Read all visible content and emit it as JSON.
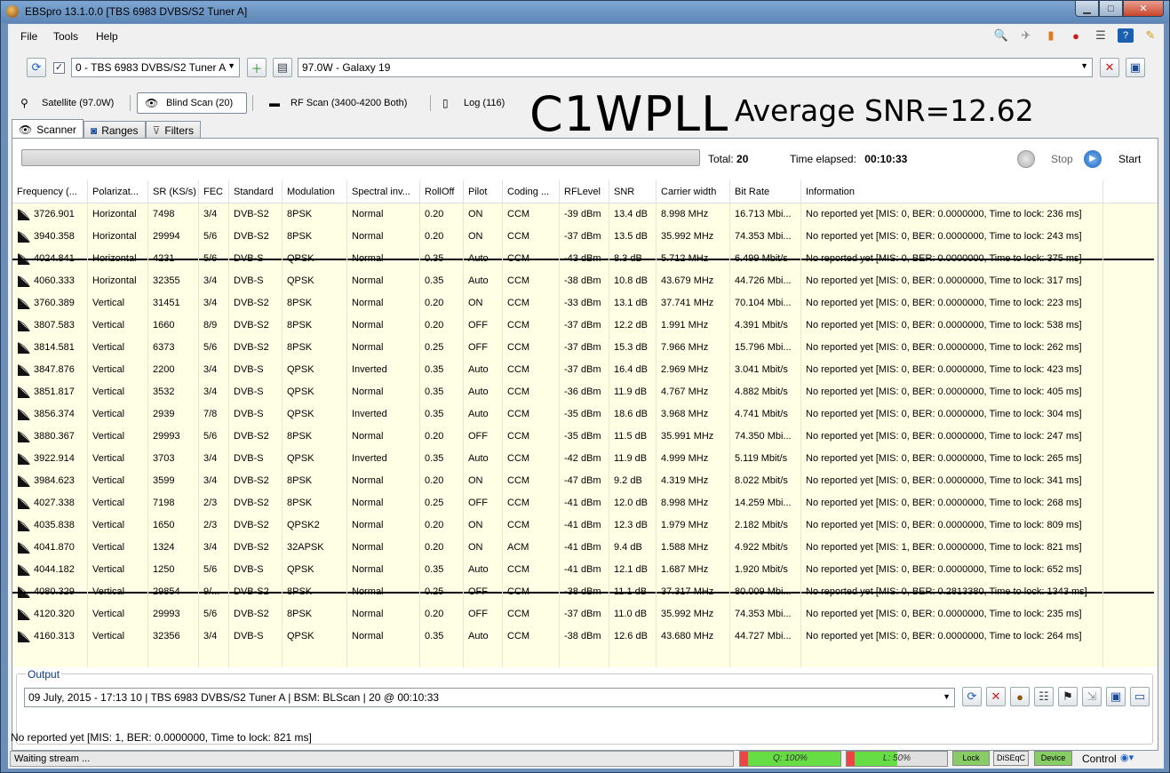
{
  "window": {
    "title": "EBSpro 13.1.0.0 [TBS 6983 DVBS/S2 Tuner A]"
  },
  "menu": {
    "file": "File",
    "tools": "Tools",
    "help": "Help"
  },
  "toolbar": {
    "tuner": "0 - TBS 6983 DVBS/S2 Tuner A",
    "satellite": "97.0W - Galaxy 19"
  },
  "tabs": {
    "satellite": "Satellite (97.0W)",
    "blind_scan": "Blind Scan (20)",
    "rf_scan": "RF Scan (3400-4200 Both)",
    "log": "Log (116)"
  },
  "overlay": {
    "callsign": "C1WPLL",
    "avg_snr": "Average SNR=12.62"
  },
  "subtabs": {
    "scanner": "Scanner",
    "ranges": "Ranges",
    "filters": "Filters"
  },
  "scanner": {
    "total_label": "Total:",
    "total_value": "20",
    "elapsed_label": "Time elapsed:",
    "elapsed_value": "00:10:33",
    "stop": "Stop",
    "start": "Start"
  },
  "columns": [
    "Frequency (...",
    "Polarizat...",
    "SR (KS/s)",
    "FEC",
    "Standard",
    "Modulation",
    "Spectral inv...",
    "RollOff",
    "Pilot",
    "Coding ...",
    "RFLevel",
    "SNR",
    "Carrier width",
    "Bit Rate",
    "Information"
  ],
  "rows": [
    {
      "f": "3726.901",
      "p": "Horizontal",
      "sr": "7498",
      "fec": "3/4",
      "std": "DVB-S2",
      "mod": "8PSK",
      "inv": "Normal",
      "ro": "0.20",
      "pilot": "ON",
      "cod": "CCM",
      "rf": "-39 dBm",
      "snr": "13.4 dB",
      "cw": "8.998 MHz",
      "br": "16.713 Mbi...",
      "info": "No reported yet [MIS: 0, BER: 0.0000000, Time to lock: 236 ms]",
      "struck": false
    },
    {
      "f": "3940.358",
      "p": "Horizontal",
      "sr": "29994",
      "fec": "5/6",
      "std": "DVB-S2",
      "mod": "8PSK",
      "inv": "Normal",
      "ro": "0.20",
      "pilot": "ON",
      "cod": "CCM",
      "rf": "-37 dBm",
      "snr": "13.5 dB",
      "cw": "35.992 MHz",
      "br": "74.353 Mbi...",
      "info": "No reported yet [MIS: 0, BER: 0.0000000, Time to lock: 243 ms]",
      "struck": false
    },
    {
      "f": "4024.841",
      "p": "Horizontal",
      "sr": "4231",
      "fec": "5/6",
      "std": "DVB-S",
      "mod": "QPSK",
      "inv": "Normal",
      "ro": "0.35",
      "pilot": "Auto",
      "cod": "CCM",
      "rf": "-43 dBm",
      "snr": "8.3 dB",
      "cw": "5.712 MHz",
      "br": "6.499 Mbit/s",
      "info": "No reported yet [MIS: 0, BER: 0.0000000, Time to lock: 375 ms]",
      "struck": true
    },
    {
      "f": "4060.333",
      "p": "Horizontal",
      "sr": "32355",
      "fec": "3/4",
      "std": "DVB-S",
      "mod": "QPSK",
      "inv": "Normal",
      "ro": "0.35",
      "pilot": "Auto",
      "cod": "CCM",
      "rf": "-38 dBm",
      "snr": "10.8 dB",
      "cw": "43.679 MHz",
      "br": "44.726 Mbi...",
      "info": "No reported yet [MIS: 0, BER: 0.0000000, Time to lock: 317 ms]",
      "struck": false
    },
    {
      "f": "3760.389",
      "p": "Vertical",
      "sr": "31451",
      "fec": "3/4",
      "std": "DVB-S2",
      "mod": "8PSK",
      "inv": "Normal",
      "ro": "0.20",
      "pilot": "ON",
      "cod": "CCM",
      "rf": "-33 dBm",
      "snr": "13.1 dB",
      "cw": "37.741 MHz",
      "br": "70.104 Mbi...",
      "info": "No reported yet [MIS: 0, BER: 0.0000000, Time to lock: 223 ms]",
      "struck": false
    },
    {
      "f": "3807.583",
      "p": "Vertical",
      "sr": "1660",
      "fec": "8/9",
      "std": "DVB-S2",
      "mod": "8PSK",
      "inv": "Normal",
      "ro": "0.20",
      "pilot": "OFF",
      "cod": "CCM",
      "rf": "-37 dBm",
      "snr": "12.2 dB",
      "cw": "1.991 MHz",
      "br": "4.391 Mbit/s",
      "info": "No reported yet [MIS: 0, BER: 0.0000000, Time to lock: 538 ms]",
      "struck": false
    },
    {
      "f": "3814.581",
      "p": "Vertical",
      "sr": "6373",
      "fec": "5/6",
      "std": "DVB-S2",
      "mod": "8PSK",
      "inv": "Normal",
      "ro": "0.25",
      "pilot": "OFF",
      "cod": "CCM",
      "rf": "-37 dBm",
      "snr": "15.3 dB",
      "cw": "7.966 MHz",
      "br": "15.796 Mbi...",
      "info": "No reported yet [MIS: 0, BER: 0.0000000, Time to lock: 262 ms]",
      "struck": false
    },
    {
      "f": "3847.876",
      "p": "Vertical",
      "sr": "2200",
      "fec": "3/4",
      "std": "DVB-S",
      "mod": "QPSK",
      "inv": "Inverted",
      "ro": "0.35",
      "pilot": "Auto",
      "cod": "CCM",
      "rf": "-37 dBm",
      "snr": "16.4 dB",
      "cw": "2.969 MHz",
      "br": "3.041 Mbit/s",
      "info": "No reported yet [MIS: 0, BER: 0.0000000, Time to lock: 423 ms]",
      "struck": false
    },
    {
      "f": "3851.817",
      "p": "Vertical",
      "sr": "3532",
      "fec": "3/4",
      "std": "DVB-S",
      "mod": "QPSK",
      "inv": "Normal",
      "ro": "0.35",
      "pilot": "Auto",
      "cod": "CCM",
      "rf": "-36 dBm",
      "snr": "11.9 dB",
      "cw": "4.767 MHz",
      "br": "4.882 Mbit/s",
      "info": "No reported yet [MIS: 0, BER: 0.0000000, Time to lock: 405 ms]",
      "struck": false
    },
    {
      "f": "3856.374",
      "p": "Vertical",
      "sr": "2939",
      "fec": "7/8",
      "std": "DVB-S",
      "mod": "QPSK",
      "inv": "Inverted",
      "ro": "0.35",
      "pilot": "Auto",
      "cod": "CCM",
      "rf": "-35 dBm",
      "snr": "18.6 dB",
      "cw": "3.968 MHz",
      "br": "4.741 Mbit/s",
      "info": "No reported yet [MIS: 0, BER: 0.0000000, Time to lock: 304 ms]",
      "struck": false
    },
    {
      "f": "3880.367",
      "p": "Vertical",
      "sr": "29993",
      "fec": "5/6",
      "std": "DVB-S2",
      "mod": "8PSK",
      "inv": "Normal",
      "ro": "0.20",
      "pilot": "OFF",
      "cod": "CCM",
      "rf": "-35 dBm",
      "snr": "11.5 dB",
      "cw": "35.991 MHz",
      "br": "74.350 Mbi...",
      "info": "No reported yet [MIS: 0, BER: 0.0000000, Time to lock: 247 ms]",
      "struck": false
    },
    {
      "f": "3922.914",
      "p": "Vertical",
      "sr": "3703",
      "fec": "3/4",
      "std": "DVB-S",
      "mod": "QPSK",
      "inv": "Inverted",
      "ro": "0.35",
      "pilot": "Auto",
      "cod": "CCM",
      "rf": "-42 dBm",
      "snr": "11.9 dB",
      "cw": "4.999 MHz",
      "br": "5.119 Mbit/s",
      "info": "No reported yet [MIS: 0, BER: 0.0000000, Time to lock: 265 ms]",
      "struck": false
    },
    {
      "f": "3984.623",
      "p": "Vertical",
      "sr": "3599",
      "fec": "3/4",
      "std": "DVB-S2",
      "mod": "8PSK",
      "inv": "Normal",
      "ro": "0.20",
      "pilot": "ON",
      "cod": "CCM",
      "rf": "-47 dBm",
      "snr": "9.2 dB",
      "cw": "4.319 MHz",
      "br": "8.022 Mbit/s",
      "info": "No reported yet [MIS: 0, BER: 0.0000000, Time to lock: 341 ms]",
      "struck": false
    },
    {
      "f": "4027.338",
      "p": "Vertical",
      "sr": "7198",
      "fec": "2/3",
      "std": "DVB-S2",
      "mod": "8PSK",
      "inv": "Normal",
      "ro": "0.25",
      "pilot": "OFF",
      "cod": "CCM",
      "rf": "-41 dBm",
      "snr": "12.0 dB",
      "cw": "8.998 MHz",
      "br": "14.259 Mbi...",
      "info": "No reported yet [MIS: 0, BER: 0.0000000, Time to lock: 268 ms]",
      "struck": false
    },
    {
      "f": "4035.838",
      "p": "Vertical",
      "sr": "1650",
      "fec": "2/3",
      "std": "DVB-S2",
      "mod": "QPSK2",
      "inv": "Normal",
      "ro": "0.20",
      "pilot": "ON",
      "cod": "CCM",
      "rf": "-41 dBm",
      "snr": "12.3 dB",
      "cw": "1.979 MHz",
      "br": "2.182 Mbit/s",
      "info": "No reported yet [MIS: 0, BER: 0.0000000, Time to lock: 809 ms]",
      "struck": false
    },
    {
      "f": "4041.870",
      "p": "Vertical",
      "sr": "1324",
      "fec": "3/4",
      "std": "DVB-S2",
      "mod": "32APSK",
      "inv": "Normal",
      "ro": "0.20",
      "pilot": "ON",
      "cod": "ACM",
      "rf": "-41 dBm",
      "snr": "9.4 dB",
      "cw": "1.588 MHz",
      "br": "4.922 Mbit/s",
      "info": "No reported yet [MIS: 1, BER: 0.0000000, Time to lock: 821 ms]",
      "struck": false
    },
    {
      "f": "4044.182",
      "p": "Vertical",
      "sr": "1250",
      "fec": "5/6",
      "std": "DVB-S",
      "mod": "QPSK",
      "inv": "Normal",
      "ro": "0.35",
      "pilot": "Auto",
      "cod": "CCM",
      "rf": "-41 dBm",
      "snr": "12.1 dB",
      "cw": "1.687 MHz",
      "br": "1.920 Mbit/s",
      "info": "No reported yet [MIS: 0, BER: 0.0000000, Time to lock: 652 ms]",
      "struck": false
    },
    {
      "f": "4080.329",
      "p": "Vertical",
      "sr": "29854",
      "fec": "9/...",
      "std": "DVB-S2",
      "mod": "8PSK",
      "inv": "Normal",
      "ro": "0.25",
      "pilot": "OFF",
      "cod": "CCM",
      "rf": "-38 dBm",
      "snr": "11.1 dB",
      "cw": "37.317 MHz",
      "br": "80.009 Mbi...",
      "info": "No reported yet [MIS: 0, BER: 0.2813380, Time to lock: 1343 ms]",
      "struck": true
    },
    {
      "f": "4120.320",
      "p": "Vertical",
      "sr": "29993",
      "fec": "5/6",
      "std": "DVB-S2",
      "mod": "8PSK",
      "inv": "Normal",
      "ro": "0.20",
      "pilot": "OFF",
      "cod": "CCM",
      "rf": "-37 dBm",
      "snr": "11.0 dB",
      "cw": "35.992 MHz",
      "br": "74.353 Mbi...",
      "info": "No reported yet [MIS: 0, BER: 0.0000000, Time to lock: 235 ms]",
      "struck": false
    },
    {
      "f": "4160.313",
      "p": "Vertical",
      "sr": "32356",
      "fec": "3/4",
      "std": "DVB-S",
      "mod": "QPSK",
      "inv": "Normal",
      "ro": "0.35",
      "pilot": "Auto",
      "cod": "CCM",
      "rf": "-38 dBm",
      "snr": "12.6 dB",
      "cw": "43.680 MHz",
      "br": "44.727 Mbi...",
      "info": "No reported yet [MIS: 0, BER: 0.0000000, Time to lock: 264 ms]",
      "struck": false
    }
  ],
  "output": {
    "label": "Output",
    "value": "09 July, 2015 - 17:13 10 | TBS 6983 DVBS/S2 Tuner A | BSM: BLScan | 20 @ 00:10:33"
  },
  "status": {
    "info": "No reported yet [MIS: 1, BER: 0.0000000, Time to lock: 821 ms]",
    "stream": "Waiting stream ...",
    "quality": "Q: 100%",
    "quality_level": 1.0,
    "level": "L: 50%",
    "level_level": 0.5,
    "lock": "Lock",
    "diseqc": "DiSEqC",
    "device": "Device",
    "control": "Control"
  },
  "colors": {
    "grid_bg": "#ffffe6",
    "meter_green": "#66dd44",
    "meter_red": "#ee4444",
    "lock_green": "#88cc66"
  }
}
